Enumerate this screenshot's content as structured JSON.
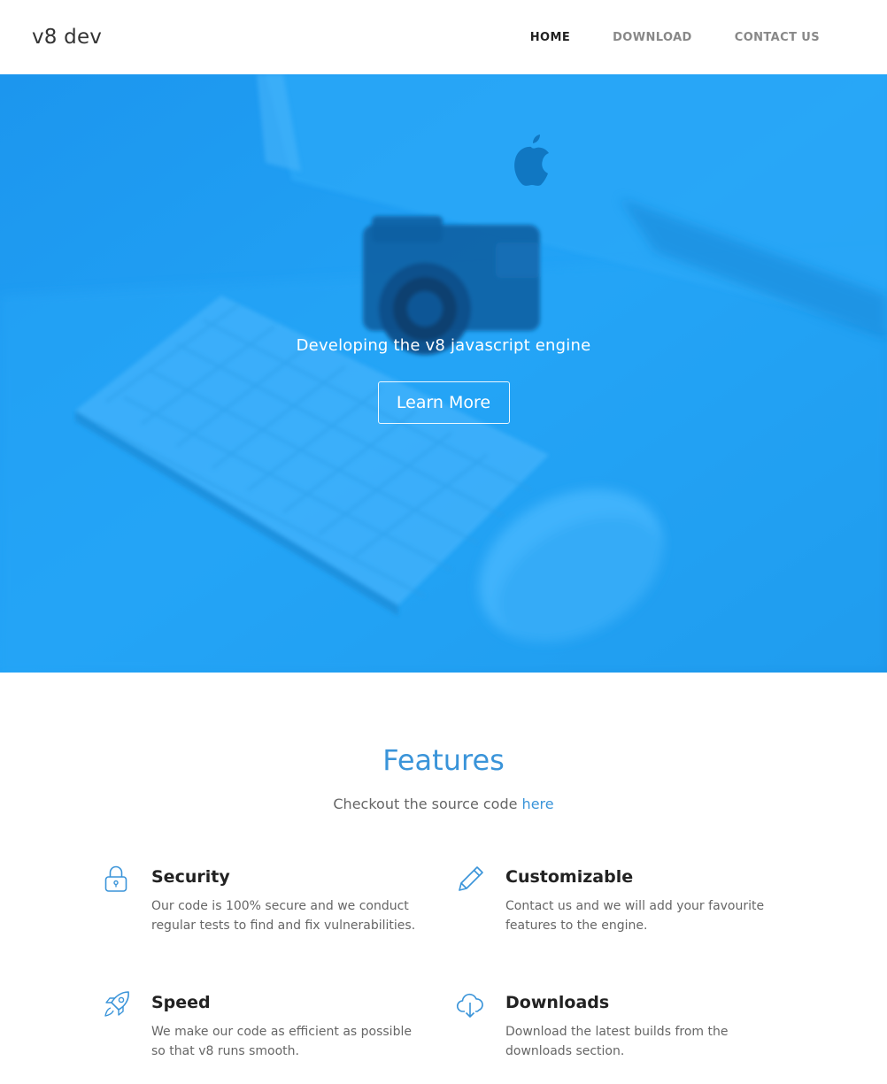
{
  "header": {
    "brand": "v8 dev",
    "nav": [
      {
        "label": "HOME",
        "active": true
      },
      {
        "label": "DOWNLOAD",
        "active": false
      },
      {
        "label": "CONTACT US",
        "active": false
      }
    ]
  },
  "hero": {
    "tagline": "Developing the v8 javascript engine",
    "button_label": "Learn More",
    "background_color": "#1f9cf0"
  },
  "features": {
    "title": "Features",
    "subtitle_prefix": "Checkout the source code ",
    "subtitle_link": "here",
    "items": [
      {
        "icon": "lock-icon",
        "title": "Security",
        "description": "Our code is 100% secure and we conduct regular tests to find and fix vulnerabilities."
      },
      {
        "icon": "pencil-icon",
        "title": "Customizable",
        "description": "Contact us and we will add your favourite features to the engine."
      },
      {
        "icon": "rocket-icon",
        "title": "Speed",
        "description": "We make our code as efficient as possible so that v8 runs smooth."
      },
      {
        "icon": "cloud-download-icon",
        "title": "Downloads",
        "description": "Download the latest builds from the downloads section."
      }
    ]
  },
  "colors": {
    "accent": "#3a94d9",
    "hero_blue": "#1f9cf0",
    "text_dark": "#222222",
    "text_muted": "#666666"
  }
}
